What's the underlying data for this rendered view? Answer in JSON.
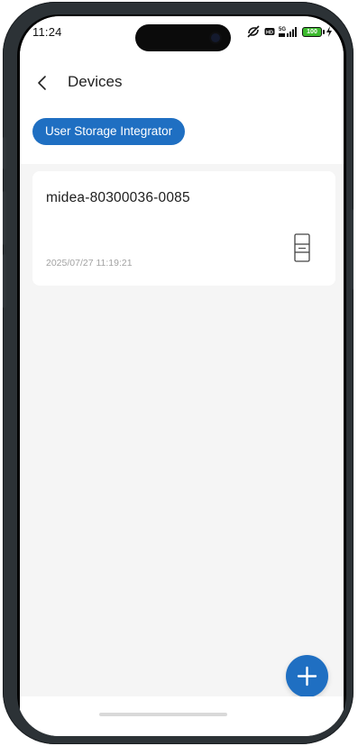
{
  "status_bar": {
    "time": "11:24",
    "network": "5G",
    "battery": "100"
  },
  "nav": {
    "title": "Devices",
    "back_icon": "chevron-left-icon"
  },
  "filter_tag": {
    "label": "User Storage Integrator"
  },
  "devices": [
    {
      "name": "midea-80300036-0085",
      "timestamp": "2025/07/27 11:19:21",
      "icon": "refrigerator-icon"
    }
  ],
  "fab": {
    "icon": "plus-icon"
  },
  "colors": {
    "accent": "#1f6fc2",
    "background": "#f5f5f5",
    "card": "#ffffff",
    "battery_green": "#3dbb2f"
  }
}
